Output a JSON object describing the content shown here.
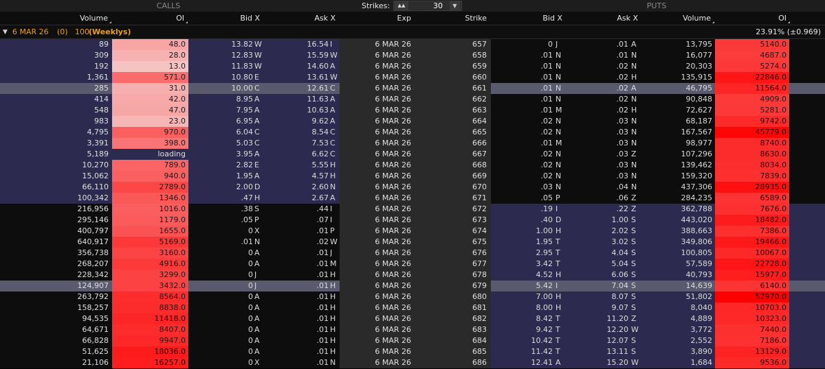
{
  "header": {
    "calls_label": "CALLS",
    "puts_label": "PUTS",
    "strikes_label": "Strikes:",
    "strikes_value": "30",
    "strikes_icon": "grid-icon",
    "dropdown_icon": "chevron-down-icon"
  },
  "columns": {
    "call_volume": "Volume",
    "call_oi": "OI",
    "call_bid": "Bid X",
    "call_ask": "Ask X",
    "exp": "Exp",
    "strike": "Strike",
    "put_bid": "Bid X",
    "put_ask": "Ask X",
    "put_volume": "Volume",
    "put_oi": "OI"
  },
  "series": {
    "expiry": "6 MAR 26",
    "count": "(0)",
    "multiplier": "100",
    "weeklys": "(Weeklys)",
    "iv": "23.91% (±0.969)"
  },
  "colors": {
    "itm_band": "#2c2a4e",
    "otm_band": "#0d0d0d",
    "highlight": "#5a5a6e",
    "oi_light": "#f3c8c8",
    "oi_max": "#ff0000"
  },
  "rows": [
    {
      "cv": "89",
      "coi": "48.0",
      "cb": "13.82",
      "cbx": "W",
      "ca": "16.54",
      "cax": "I",
      "exp": "6 MAR 26",
      "strike": "657",
      "pb": "0",
      "pbx": "J",
      "pa": ".01",
      "pax": "A",
      "pv": "13,795",
      "poi": "5140.0"
    },
    {
      "cv": "309",
      "coi": "28.0",
      "cb": "12.83",
      "cbx": "W",
      "ca": "15.59",
      "cax": "W",
      "exp": "6 MAR 26",
      "strike": "658",
      "pb": ".01",
      "pbx": "N",
      "pa": ".01",
      "pax": "N",
      "pv": "16,077",
      "poi": "4687.0"
    },
    {
      "cv": "192",
      "coi": "13.0",
      "cb": "11.83",
      "cbx": "W",
      "ca": "14.60",
      "cax": "A",
      "exp": "6 MAR 26",
      "strike": "659",
      "pb": ".01",
      "pbx": "N",
      "pa": ".02",
      "pax": "N",
      "pv": "20,303",
      "poi": "5274.0"
    },
    {
      "cv": "1,361",
      "coi": "571.0",
      "cb": "10.80",
      "cbx": "E",
      "ca": "13.61",
      "cax": "W",
      "exp": "6 MAR 26",
      "strike": "660",
      "pb": ".01",
      "pbx": "N",
      "pa": ".02",
      "pax": "H",
      "pv": "135,915",
      "poi": "22846.0"
    },
    {
      "cv": "285",
      "coi": "31.0",
      "cb": "10.00",
      "cbx": "C",
      "ca": "12.61",
      "cax": "C",
      "exp": "6 MAR 26",
      "strike": "661",
      "pb": ".01",
      "pbx": "N",
      "pa": ".02",
      "pax": "A",
      "pv": "46,795",
      "poi": "11564.0",
      "hl": true
    },
    {
      "cv": "414",
      "coi": "42.0",
      "cb": "8.95",
      "cbx": "A",
      "ca": "11.63",
      "cax": "A",
      "exp": "6 MAR 26",
      "strike": "662",
      "pb": ".01",
      "pbx": "N",
      "pa": ".02",
      "pax": "N",
      "pv": "90,848",
      "poi": "4909.0"
    },
    {
      "cv": "548",
      "coi": "47.0",
      "cb": "7.95",
      "cbx": "A",
      "ca": "10.63",
      "cax": "A",
      "exp": "6 MAR 26",
      "strike": "663",
      "pb": ".01",
      "pbx": "M",
      "pa": ".02",
      "pax": "H",
      "pv": "72,627",
      "poi": "5281.0"
    },
    {
      "cv": "983",
      "coi": "23.0",
      "cb": "6.95",
      "cbx": "A",
      "ca": "9.62",
      "cax": "A",
      "exp": "6 MAR 26",
      "strike": "664",
      "pb": ".02",
      "pbx": "N",
      "pa": ".03",
      "pax": "N",
      "pv": "68,187",
      "poi": "9742.0"
    },
    {
      "cv": "4,795",
      "coi": "970.0",
      "cb": "6.04",
      "cbx": "C",
      "ca": "8.54",
      "cax": "C",
      "exp": "6 MAR 26",
      "strike": "665",
      "pb": ".02",
      "pbx": "N",
      "pa": ".03",
      "pax": "N",
      "pv": "167,567",
      "poi": "45779.0"
    },
    {
      "cv": "3,391",
      "coi": "398.0",
      "cb": "5.03",
      "cbx": "C",
      "ca": "7.53",
      "cax": "C",
      "exp": "6 MAR 26",
      "strike": "666",
      "pb": ".01",
      "pbx": "M",
      "pa": ".03",
      "pax": "N",
      "pv": "98,977",
      "poi": "8740.0"
    },
    {
      "cv": "5,189",
      "coi": "loading",
      "cb": "3.95",
      "cbx": "A",
      "ca": "6.62",
      "cax": "C",
      "exp": "6 MAR 26",
      "strike": "667",
      "pb": ".02",
      "pbx": "N",
      "pa": ".03",
      "pax": "Z",
      "pv": "107,296",
      "poi": "8630.0"
    },
    {
      "cv": "10,270",
      "coi": "789.0",
      "cb": "2.82",
      "cbx": "E",
      "ca": "5.55",
      "cax": "H",
      "exp": "6 MAR 26",
      "strike": "668",
      "pb": ".02",
      "pbx": "N",
      "pa": ".03",
      "pax": "N",
      "pv": "139,462",
      "poi": "8034.0"
    },
    {
      "cv": "15,062",
      "coi": "940.0",
      "cb": "1.95",
      "cbx": "A",
      "ca": "4.57",
      "cax": "H",
      "exp": "6 MAR 26",
      "strike": "669",
      "pb": ".02",
      "pbx": "N",
      "pa": ".03",
      "pax": "N",
      "pv": "159,320",
      "poi": "7839.0"
    },
    {
      "cv": "66,110",
      "coi": "2789.0",
      "cb": "2.00",
      "cbx": "D",
      "ca": "2.60",
      "cax": "N",
      "exp": "6 MAR 26",
      "strike": "670",
      "pb": ".03",
      "pbx": "N",
      "pa": ".04",
      "pax": "N",
      "pv": "437,306",
      "poi": "28935.0"
    },
    {
      "cv": "100,342",
      "coi": "1346.0",
      "cb": ".47",
      "cbx": "H",
      "ca": "2.67",
      "cax": "A",
      "exp": "6 MAR 26",
      "strike": "671",
      "pb": ".05",
      "pbx": "P",
      "pa": ".06",
      "pax": "Z",
      "pv": "284,235",
      "poi": "6589.0"
    },
    {
      "cv": "216,956",
      "coi": "1016.0",
      "cb": ".38",
      "cbx": "S",
      "ca": ".44",
      "cax": "I",
      "exp": "6 MAR 26",
      "strike": "672",
      "pb": ".19",
      "pbx": "I",
      "pa": ".22",
      "pax": "Z",
      "pv": "362,788",
      "poi": "7676.0"
    },
    {
      "cv": "295,146",
      "coi": "1179.0",
      "cb": ".05",
      "cbx": "P",
      "ca": ".07",
      "cax": "I",
      "exp": "6 MAR 26",
      "strike": "673",
      "pb": ".40",
      "pbx": "D",
      "pa": "1.00",
      "pax": "S",
      "pv": "443,020",
      "poi": "18482.0"
    },
    {
      "cv": "400,797",
      "coi": "1655.0",
      "cb": "0",
      "cbx": "X",
      "ca": ".01",
      "cax": "P",
      "exp": "6 MAR 26",
      "strike": "674",
      "pb": "1.00",
      "pbx": "H",
      "pa": "2.02",
      "pax": "S",
      "pv": "388,663",
      "poi": "7386.0"
    },
    {
      "cv": "640,917",
      "coi": "5169.0",
      "cb": ".01",
      "cbx": "N",
      "ca": ".02",
      "cax": "W",
      "exp": "6 MAR 26",
      "strike": "675",
      "pb": "1.95",
      "pbx": "T",
      "pa": "3.02",
      "pax": "S",
      "pv": "349,806",
      "poi": "19466.0"
    },
    {
      "cv": "356,738",
      "coi": "3160.0",
      "cb": "0",
      "cbx": "A",
      "ca": ".01",
      "cax": "J",
      "exp": "6 MAR 26",
      "strike": "676",
      "pb": "2.95",
      "pbx": "T",
      "pa": "4.04",
      "pax": "S",
      "pv": "100,805",
      "poi": "10067.0"
    },
    {
      "cv": "268,207",
      "coi": "4916.0",
      "cb": "0",
      "cbx": "A",
      "ca": ".01",
      "cax": "M",
      "exp": "6 MAR 26",
      "strike": "677",
      "pb": "3.42",
      "pbx": "T",
      "pa": "5.04",
      "pax": "S",
      "pv": "57,589",
      "poi": "22728.0"
    },
    {
      "cv": "228,342",
      "coi": "3299.0",
      "cb": "0",
      "cbx": "J",
      "ca": ".01",
      "cax": "H",
      "exp": "6 MAR 26",
      "strike": "678",
      "pb": "4.52",
      "pbx": "H",
      "pa": "6.06",
      "pax": "S",
      "pv": "40,793",
      "poi": "15977.0"
    },
    {
      "cv": "124,907",
      "coi": "3432.0",
      "cb": "0",
      "cbx": "J",
      "ca": ".01",
      "cax": "H",
      "exp": "6 MAR 26",
      "strike": "679",
      "pb": "5.42",
      "pbx": "I",
      "pa": "7.04",
      "pax": "S",
      "pv": "14,639",
      "poi": "6140.0",
      "hl": true
    },
    {
      "cv": "263,792",
      "coi": "8564.0",
      "cb": "0",
      "cbx": "A",
      "ca": ".01",
      "cax": "H",
      "exp": "6 MAR 26",
      "strike": "680",
      "pb": "7.00",
      "pbx": "H",
      "pa": "8.07",
      "pax": "S",
      "pv": "51,802",
      "poi": "57970.0"
    },
    {
      "cv": "158,257",
      "coi": "8838.0",
      "cb": "0",
      "cbx": "A",
      "ca": ".01",
      "cax": "H",
      "exp": "6 MAR 26",
      "strike": "681",
      "pb": "8.00",
      "pbx": "H",
      "pa": "9.07",
      "pax": "S",
      "pv": "8,040",
      "poi": "10703.0"
    },
    {
      "cv": "94,535",
      "coi": "11418.0",
      "cb": "0",
      "cbx": "A",
      "ca": ".01",
      "cax": "H",
      "exp": "6 MAR 26",
      "strike": "682",
      "pb": "8.42",
      "pbx": "T",
      "pa": "11.20",
      "pax": "Z",
      "pv": "4,889",
      "poi": "10323.0"
    },
    {
      "cv": "64,671",
      "coi": "8407.0",
      "cb": "0",
      "cbx": "A",
      "ca": ".01",
      "cax": "H",
      "exp": "6 MAR 26",
      "strike": "683",
      "pb": "9.42",
      "pbx": "T",
      "pa": "12.20",
      "pax": "W",
      "pv": "3,772",
      "poi": "7440.0"
    },
    {
      "cv": "66,828",
      "coi": "9947.0",
      "cb": "0",
      "cbx": "A",
      "ca": ".01",
      "cax": "H",
      "exp": "6 MAR 26",
      "strike": "684",
      "pb": "10.42",
      "pbx": "T",
      "pa": "12.07",
      "pax": "S",
      "pv": "2,552",
      "poi": "7186.0"
    },
    {
      "cv": "51,625",
      "coi": "18036.0",
      "cb": "0",
      "cbx": "A",
      "ca": ".01",
      "cax": "H",
      "exp": "6 MAR 26",
      "strike": "685",
      "pb": "11.42",
      "pbx": "T",
      "pa": "13.11",
      "pax": "S",
      "pv": "3,890",
      "poi": "13129.0"
    },
    {
      "cv": "21,106",
      "coi": "16257.0",
      "cb": "0",
      "cbx": "X",
      "ca": ".01",
      "cax": "N",
      "exp": "6 MAR 26",
      "strike": "686",
      "pb": "12.41",
      "pbx": "A",
      "pa": "15.20",
      "pax": "W",
      "pv": "1,684",
      "poi": "9536.0"
    }
  ]
}
